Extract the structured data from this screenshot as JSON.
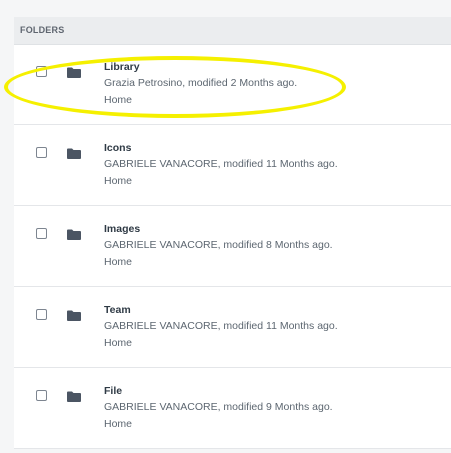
{
  "header": {
    "label": "FOLDERS"
  },
  "folders": [
    {
      "name": "Library",
      "meta": "Grazia Petrosino, modified 2 Months ago.",
      "path": "Home",
      "highlighted": true
    },
    {
      "name": "Icons",
      "meta": "GABRIELE VANACORE, modified 11 Months ago.",
      "path": "Home"
    },
    {
      "name": "Images",
      "meta": "GABRIELE VANACORE, modified 8 Months ago.",
      "path": "Home"
    },
    {
      "name": "Team",
      "meta": "GABRIELE VANACORE, modified 11 Months ago.",
      "path": "Home"
    },
    {
      "name": "File",
      "meta": "GABRIELE VANACORE, modified 9 Months ago.",
      "path": "Home"
    }
  ],
  "icons": {
    "row_icon": "folder-icon",
    "select_control": "checkbox"
  },
  "colors": {
    "highlight": "#f5f000",
    "folder_icon": "#4b5563",
    "text_primary": "#2f3a45",
    "text_secondary": "#5c6670"
  }
}
